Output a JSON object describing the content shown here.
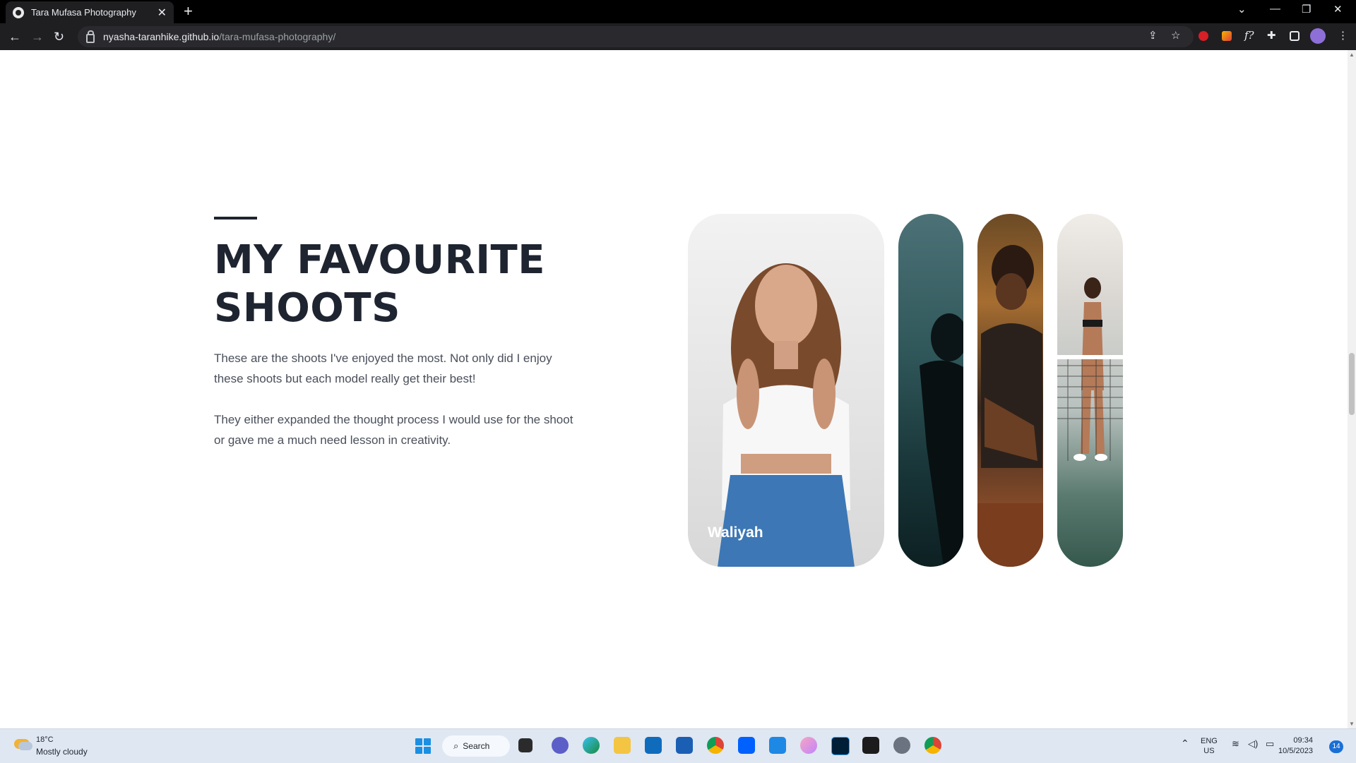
{
  "browser": {
    "tab_title": "Tara Mufasa Photography",
    "url_host": "nyasha-taranhike.github.io",
    "url_path": "/tara-mufasa-photography/"
  },
  "section": {
    "heading": "MY FAVOURITE SHOOTS",
    "paragraph_1": "These are the shoots I've enjoyed the most. Not only did I enjoy these shoots but each model really get their best!",
    "paragraph_2": "They either expanded the thought process I would use for the shoot or gave me a much need lesson in creativity."
  },
  "gallery": {
    "featured_caption": "Waliyah"
  },
  "taskbar": {
    "weather_temp": "18°C",
    "weather_desc": "Mostly cloudy",
    "search_label": "Search",
    "lang_top": "ENG",
    "lang_bottom": "US",
    "time": "09:34",
    "date": "10/5/2023",
    "notifications": "14"
  }
}
